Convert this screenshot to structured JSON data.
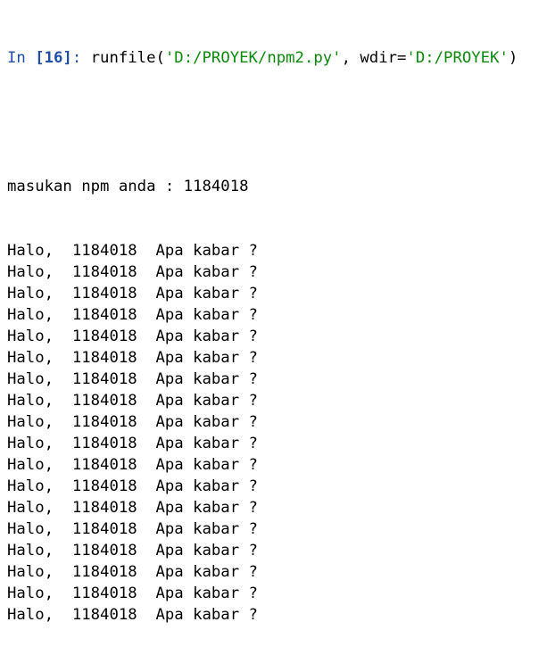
{
  "input_prompt": {
    "in_label": "In ",
    "number": "[16]",
    "suffix": ": ",
    "func": "runfile(",
    "arg1": "'D:/PROYEK/npm2.py'",
    "sep": ", wdir=",
    "arg2": "'D:/PROYEK'",
    "close": ")"
  },
  "output": {
    "prompt_line": "masukan npm anda : 1184018",
    "lines": [
      "Halo,  1184018  Apa kabar ?",
      "Halo,  1184018  Apa kabar ?",
      "Halo,  1184018  Apa kabar ?",
      "Halo,  1184018  Apa kabar ?",
      "Halo,  1184018  Apa kabar ?",
      "Halo,  1184018  Apa kabar ?",
      "Halo,  1184018  Apa kabar ?",
      "Halo,  1184018  Apa kabar ?",
      "Halo,  1184018  Apa kabar ?",
      "Halo,  1184018  Apa kabar ?",
      "Halo,  1184018  Apa kabar ?",
      "Halo,  1184018  Apa kabar ?",
      "Halo,  1184018  Apa kabar ?",
      "Halo,  1184018  Apa kabar ?",
      "Halo,  1184018  Apa kabar ?",
      "Halo,  1184018  Apa kabar ?",
      "Halo,  1184018  Apa kabar ?",
      "Halo,  1184018  Apa kabar ?"
    ]
  },
  "colors": {
    "prompt": "#1f4fa8",
    "string": "#0c8a0c",
    "text": "#000000",
    "background": "#ffffff"
  }
}
